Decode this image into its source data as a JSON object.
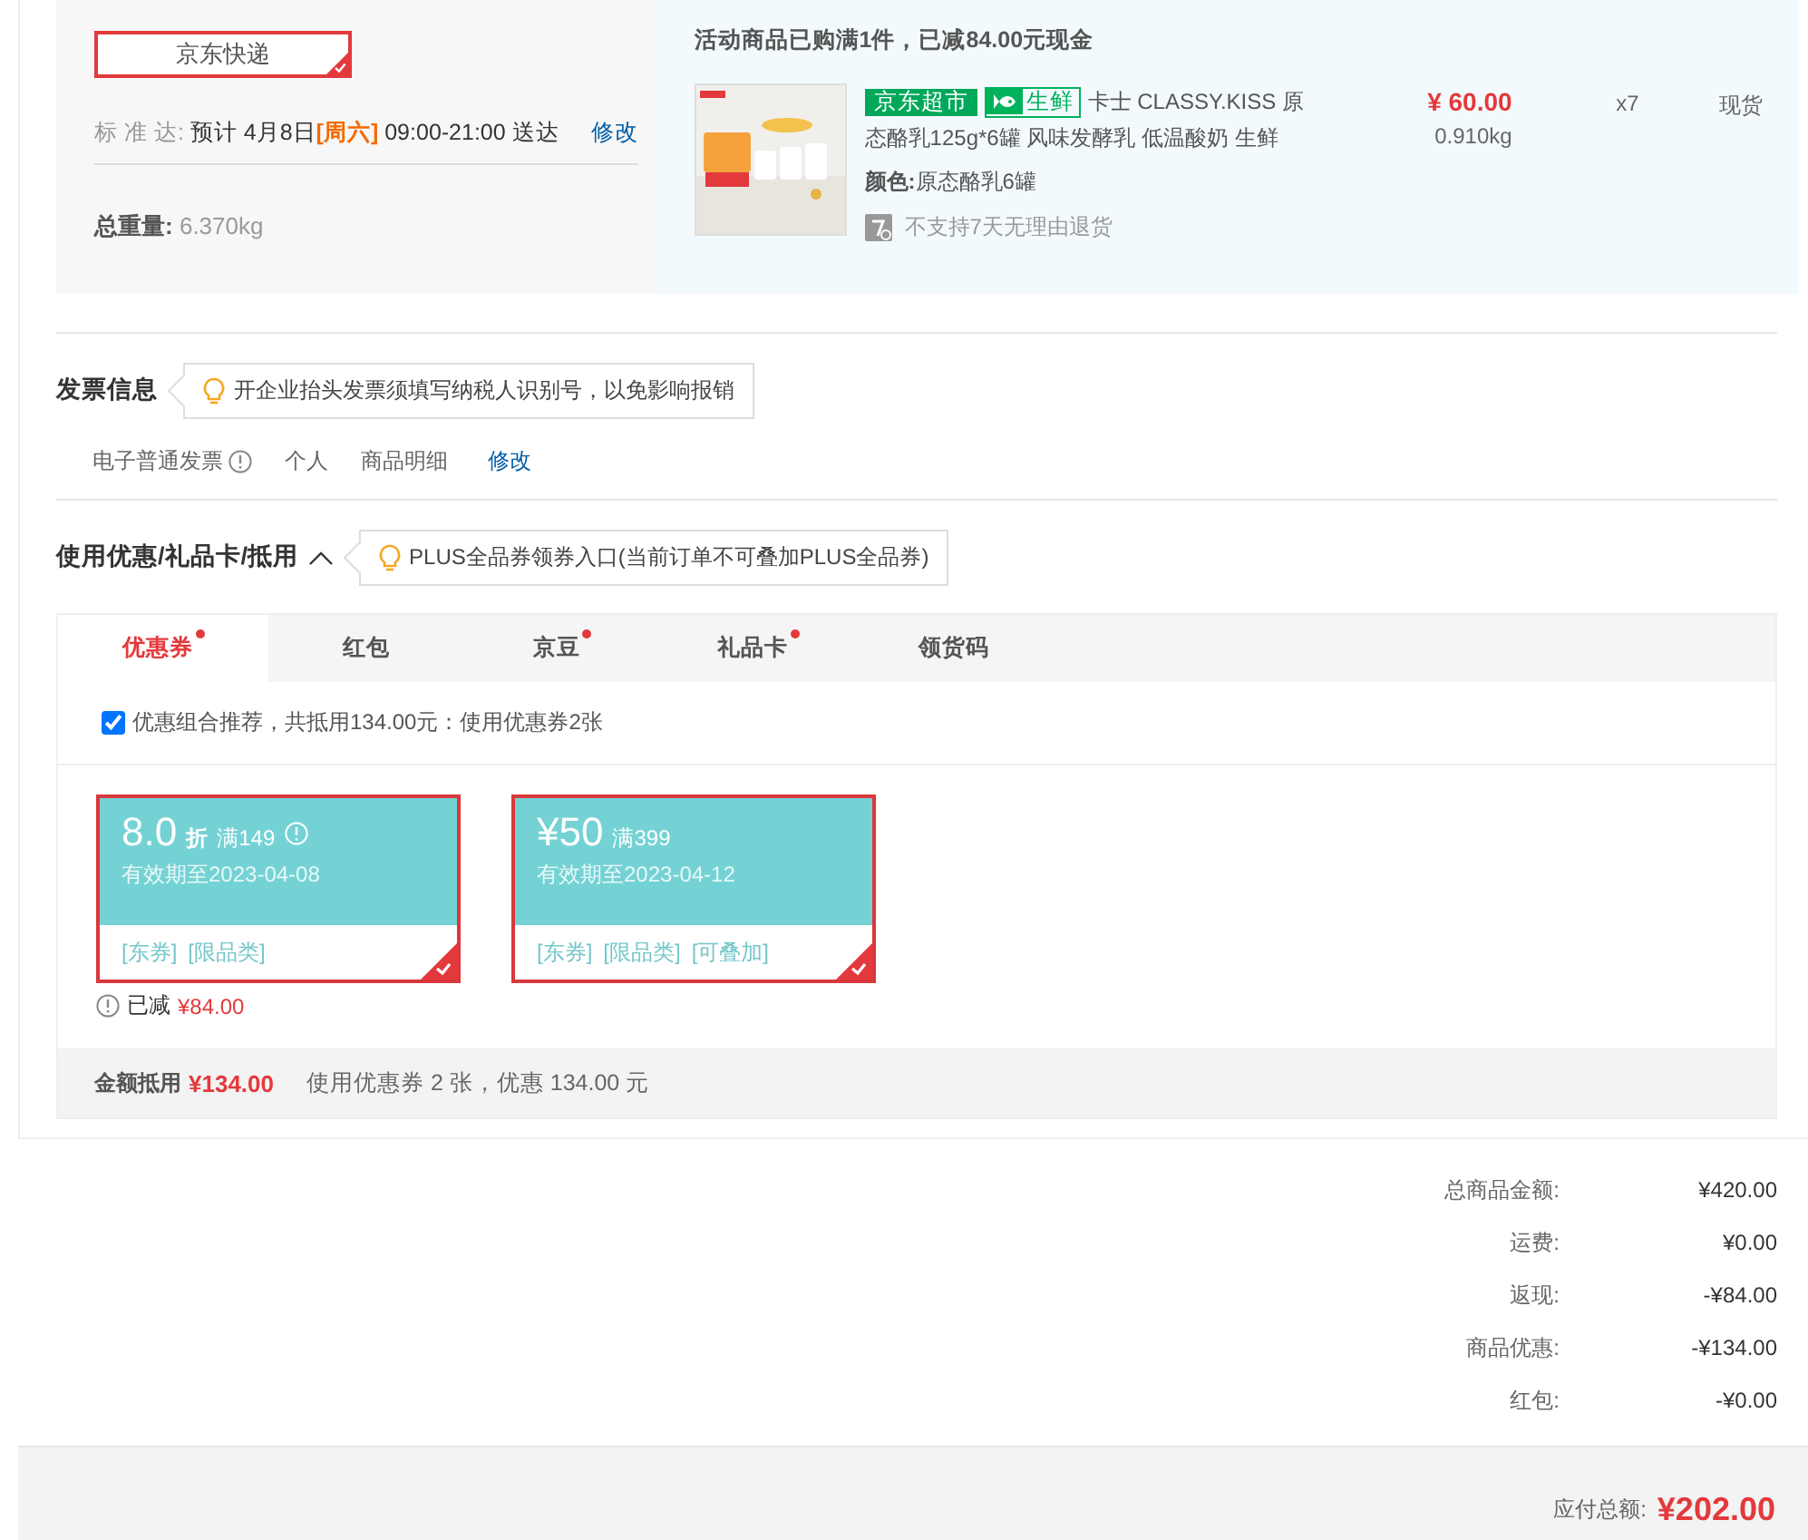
{
  "shipping": {
    "methods": [
      {
        "label": "京东快递",
        "selected": true
      }
    ],
    "eta_label": "标 准 达:",
    "eta_prefix": "预计 4月8日",
    "eta_day": "[周六]",
    "eta_time": "09:00-21:00 送达",
    "edit_link": "修改",
    "weight_label": "总重量:",
    "weight": "6.370kg"
  },
  "promo": {
    "notice": "活动商品已购满1件，已减84.00元现金",
    "product": {
      "image": {
        "kind": "picture"
      },
      "tags": [
        {
          "text": "京东超市",
          "kind": "store"
        },
        {
          "text": "生鲜",
          "kind": "fresh"
        }
      ],
      "name_lines": [
        "卡士 CLASSY.KISS 原",
        "态酪乳125g*6罐 风味发酵乳 低温酸奶 生鲜"
      ],
      "price": "¥ 60.00",
      "weight": "0.910kg",
      "quantity": "x7",
      "stock": "现货",
      "spec_label": "颜色:",
      "spec_value": "原态酪乳6罐",
      "return_policy": "不支持7天无理由退货"
    }
  },
  "invoice": {
    "title": "发票信息",
    "tip": "开企业抬头发票须填写纳税人识别号，以免影响报销",
    "type": "电子普通发票",
    "items": [
      "个人",
      "商品明细"
    ],
    "edit_link": "修改"
  },
  "discounts": {
    "title": "使用优惠/礼品卡/抵用",
    "expanded": true,
    "tip": "PLUS全品券领券入口(当前订单不可叠加PLUS全品券)",
    "tabs": [
      {
        "label": "优惠券",
        "selected": true,
        "dot": true
      },
      {
        "label": "红包",
        "selected": false,
        "dot": false
      },
      {
        "label": "京豆",
        "selected": false,
        "dot": true
      },
      {
        "label": "礼品卡",
        "selected": false,
        "dot": true
      },
      {
        "label": "领货码",
        "selected": false,
        "dot": false
      }
    ],
    "recommend": {
      "checked": true,
      "text": "优惠组合推荐，共抵用134.00元：使用优惠券2张"
    },
    "coupons": [
      {
        "amount": "8.0",
        "unit": "折",
        "condition": "满149",
        "info": true,
        "validity": "有效期至2023-04-08",
        "tags": [
          "[东券]",
          "[限品类]"
        ],
        "selected": true,
        "note_label": "已减",
        "note_amount": "¥84.00"
      },
      {
        "amount": "¥50",
        "condition": "满399",
        "info": false,
        "validity": "有效期至2023-04-12",
        "tags": [
          "[东券]",
          "[限品类]",
          "[可叠加]"
        ],
        "selected": true
      }
    ],
    "summary_label": "金额抵用",
    "summary_amount": "¥134.00",
    "summary_text": "使用优惠券 2 张，优惠 134.00 元"
  },
  "totals": [
    {
      "label": "总商品金额:",
      "value": "¥420.00"
    },
    {
      "label": "运费:",
      "value": "¥0.00"
    },
    {
      "label": "返现:",
      "value": "-¥84.00"
    },
    {
      "label": "商品优惠:",
      "value": "-¥134.00"
    },
    {
      "label": "红包:",
      "value": "-¥0.00"
    }
  ],
  "payable": {
    "label": "应付总额:",
    "amount": "¥202.00"
  }
}
